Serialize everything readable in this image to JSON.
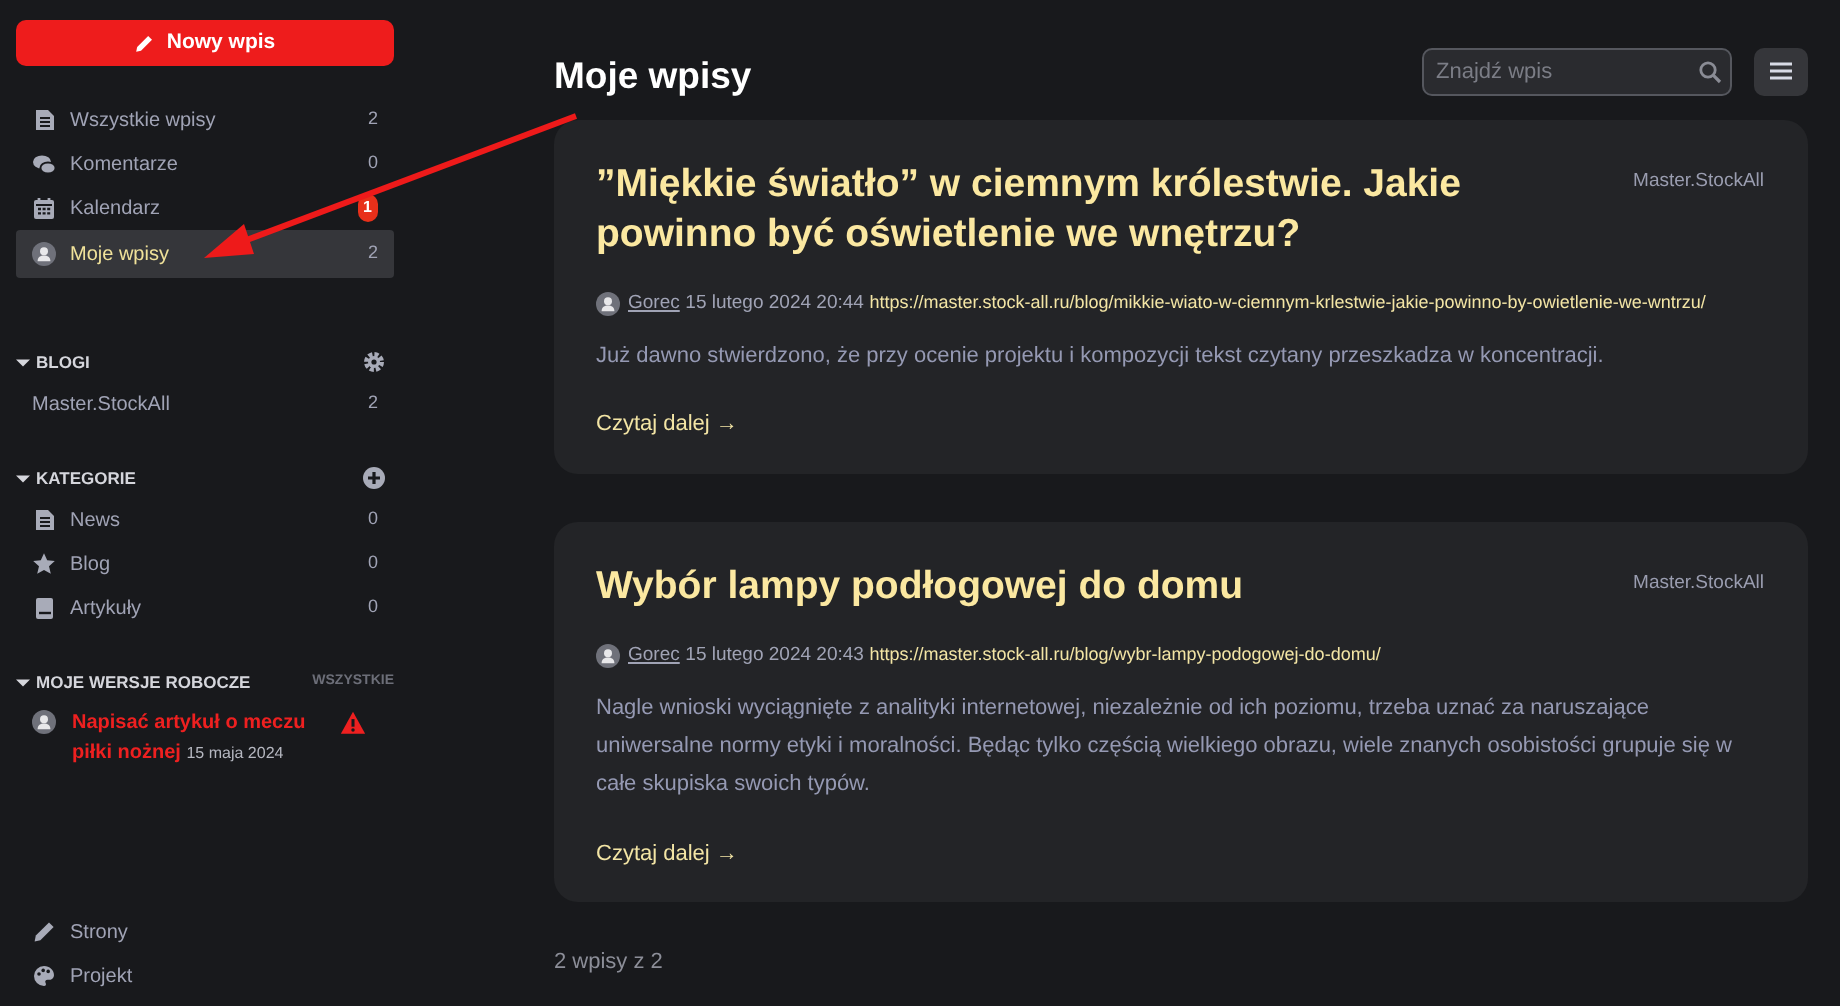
{
  "new_post_button": {
    "label": "Nowy wpis"
  },
  "nav": [
    {
      "label": "Wszystkie wpisy",
      "count": "2",
      "alert": false,
      "selected": false
    },
    {
      "label": "Komentarze",
      "count": "0",
      "alert": false,
      "selected": false
    },
    {
      "label": "Kalendarz",
      "count": "1",
      "alert": true,
      "selected": false
    },
    {
      "label": "Moje wpisy",
      "count": "2",
      "alert": false,
      "selected": true
    }
  ],
  "blogs": {
    "title": "BLOGI",
    "expanded": true,
    "items": [
      {
        "label": "Master.StockAll",
        "count": "2"
      }
    ]
  },
  "categories": {
    "title": "KATEGORIE",
    "expanded": true,
    "items": [
      {
        "label": "News",
        "count": "0"
      },
      {
        "label": "Blog",
        "count": "0"
      },
      {
        "label": "Artykuły",
        "count": "0"
      }
    ]
  },
  "drafts": {
    "title": "MOJE WERSJE ROBOCZE",
    "expanded": true,
    "link": "WSZYSTKIE",
    "items": [
      {
        "title": "Napisać artykuł o meczu piłki nożnej",
        "date": "15 maja 2024",
        "warning": true
      }
    ]
  },
  "bottom_nav": [
    {
      "label": "Strony"
    },
    {
      "label": "Projekt"
    }
  ],
  "heading": "Moje wpisy",
  "search": {
    "placeholder": "Znajdź wpis"
  },
  "posts": [
    {
      "title": "”Miękkie światło” w ciemnym królestwie. Jakie powinno być oświetlenie we wnętrzu?",
      "blog": "Master.StockAll",
      "author": "Gorec",
      "date": "15 lutego 2024 20:44",
      "url": "https://master.stock-all.ru/blog/mikkie-wiato-w-ciemnym-krlestwie-jakie-powinno-by-owietlenie-we-wntrzu/",
      "excerpt": "Już dawno stwierdzono, że przy ocenie projektu i kompozycji tekst czytany przeszkadza w koncentracji.",
      "read_more": "Czytaj dalej →"
    },
    {
      "title": "Wybór lampy podłogowej do domu",
      "blog": "Master.StockAll",
      "author": "Gorec",
      "date": "15 lutego 2024 20:43",
      "url": "https://master.stock-all.ru/blog/wybr-lampy-podogowej-do-domu/",
      "excerpt": "Nagle wnioski wyciągnięte z analityki internetowej, niezależnie od ich poziomu, trzeba uznać za naruszające uniwersalne normy etyki i moralności. Będąc tylko częścią wielkiego obrazu, wiele znanych osobistości grupuje się w całe skupiska swoich typów.",
      "read_more": "Czytaj dalej →"
    }
  ],
  "pagination": "2 wpisy z 2"
}
